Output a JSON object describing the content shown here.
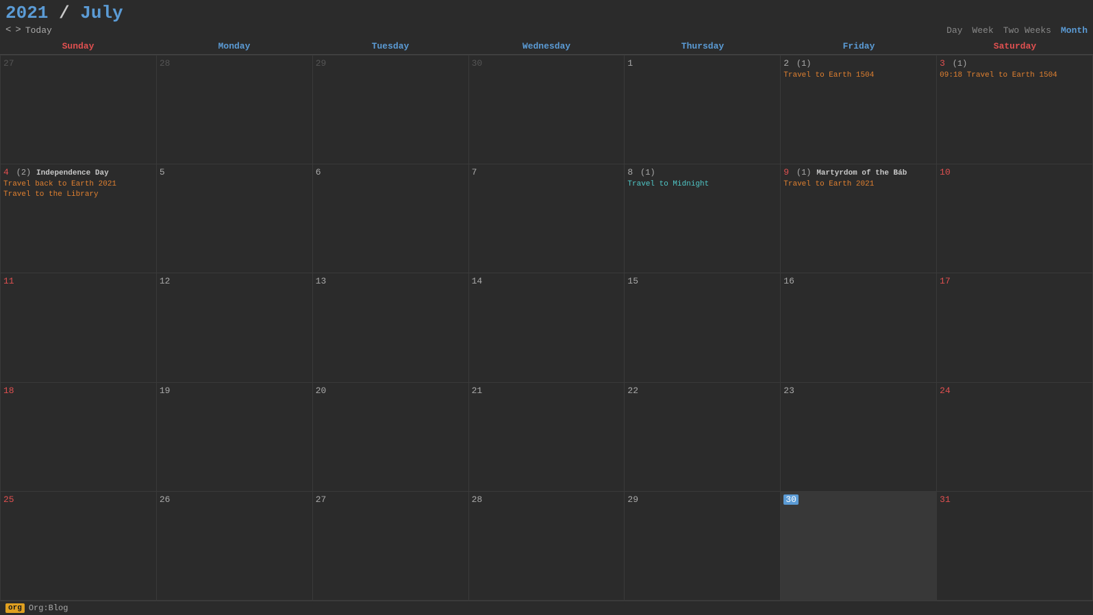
{
  "header": {
    "year": "2021",
    "slash": " / ",
    "month": "July",
    "nav": {
      "prev": "<",
      "next": ">",
      "today": "Today"
    },
    "views": [
      "Day",
      "Week",
      "Two Weeks",
      "Month"
    ],
    "active_view": "Month"
  },
  "day_headers": [
    {
      "label": "Sunday",
      "type": "weekend"
    },
    {
      "label": "Monday",
      "type": "weekday"
    },
    {
      "label": "Tuesday",
      "type": "weekday"
    },
    {
      "label": "Wednesday",
      "type": "weekday"
    },
    {
      "label": "Thursday",
      "type": "weekday"
    },
    {
      "label": "Friday",
      "type": "weekday"
    },
    {
      "label": "Saturday",
      "type": "weekend"
    }
  ],
  "weeks": [
    {
      "days": [
        {
          "num": "27",
          "type": "other",
          "weekend": true,
          "events": []
        },
        {
          "num": "28",
          "type": "other",
          "weekend": false,
          "events": []
        },
        {
          "num": "29",
          "type": "other",
          "weekend": false,
          "events": []
        },
        {
          "num": "30",
          "type": "other",
          "weekend": false,
          "events": []
        },
        {
          "num": "1",
          "type": "current",
          "weekend": false,
          "events": []
        },
        {
          "num": "2",
          "type": "current",
          "weekend": false,
          "count": "(1)",
          "events": [
            {
              "text": "Travel to Earth 1504",
              "style": "orange"
            }
          ]
        },
        {
          "num": "3",
          "type": "current",
          "weekend": true,
          "count": "(1)",
          "events": [
            {
              "time": "09:18",
              "text": "Travel to Earth 1504",
              "style": "orange"
            }
          ]
        }
      ]
    },
    {
      "days": [
        {
          "num": "4",
          "type": "current",
          "weekend": true,
          "count": "(2)",
          "holiday": "Independence Day",
          "events": [
            {
              "text": "Travel back to Earth 2021",
              "style": "orange"
            },
            {
              "text": "Travel to the Library",
              "style": "orange"
            }
          ]
        },
        {
          "num": "5",
          "type": "current",
          "weekend": false,
          "events": []
        },
        {
          "num": "6",
          "type": "current",
          "weekend": false,
          "events": []
        },
        {
          "num": "7",
          "type": "current",
          "weekend": false,
          "events": []
        },
        {
          "num": "8",
          "type": "current",
          "weekend": false,
          "count": "(1)",
          "events": [
            {
              "text": "Travel to Midnight",
              "style": "cyan"
            }
          ]
        },
        {
          "num": "9",
          "type": "current",
          "weekend": false,
          "count": "(1)",
          "holiday": "Martyrdom of the Báb",
          "events": [
            {
              "text": "Travel to Earth 2021",
              "style": "orange"
            }
          ]
        },
        {
          "num": "10",
          "type": "current",
          "weekend": true,
          "events": []
        }
      ]
    },
    {
      "days": [
        {
          "num": "11",
          "type": "current",
          "weekend": true,
          "events": []
        },
        {
          "num": "12",
          "type": "current",
          "weekend": false,
          "events": []
        },
        {
          "num": "13",
          "type": "current",
          "weekend": false,
          "events": []
        },
        {
          "num": "14",
          "type": "current",
          "weekend": false,
          "events": []
        },
        {
          "num": "15",
          "type": "current",
          "weekend": false,
          "events": []
        },
        {
          "num": "16",
          "type": "current",
          "weekend": false,
          "events": []
        },
        {
          "num": "17",
          "type": "current",
          "weekend": true,
          "events": []
        }
      ]
    },
    {
      "days": [
        {
          "num": "18",
          "type": "current",
          "weekend": true,
          "events": []
        },
        {
          "num": "19",
          "type": "current",
          "weekend": false,
          "events": []
        },
        {
          "num": "20",
          "type": "current",
          "weekend": false,
          "events": []
        },
        {
          "num": "21",
          "type": "current",
          "weekend": false,
          "events": []
        },
        {
          "num": "22",
          "type": "current",
          "weekend": false,
          "events": []
        },
        {
          "num": "23",
          "type": "current",
          "weekend": false,
          "events": []
        },
        {
          "num": "24",
          "type": "current",
          "weekend": true,
          "events": []
        }
      ]
    },
    {
      "days": [
        {
          "num": "25",
          "type": "current",
          "weekend": true,
          "events": []
        },
        {
          "num": "26",
          "type": "current",
          "weekend": false,
          "events": []
        },
        {
          "num": "27",
          "type": "current",
          "weekend": false,
          "events": []
        },
        {
          "num": "28",
          "type": "current",
          "weekend": false,
          "events": []
        },
        {
          "num": "29",
          "type": "current",
          "weekend": false,
          "events": []
        },
        {
          "num": "30",
          "type": "current",
          "weekend": false,
          "today": true,
          "events": []
        },
        {
          "num": "31",
          "type": "current",
          "weekend": true,
          "events": []
        }
      ]
    }
  ],
  "footer": {
    "tag": "org",
    "label": "Org:Blog"
  }
}
